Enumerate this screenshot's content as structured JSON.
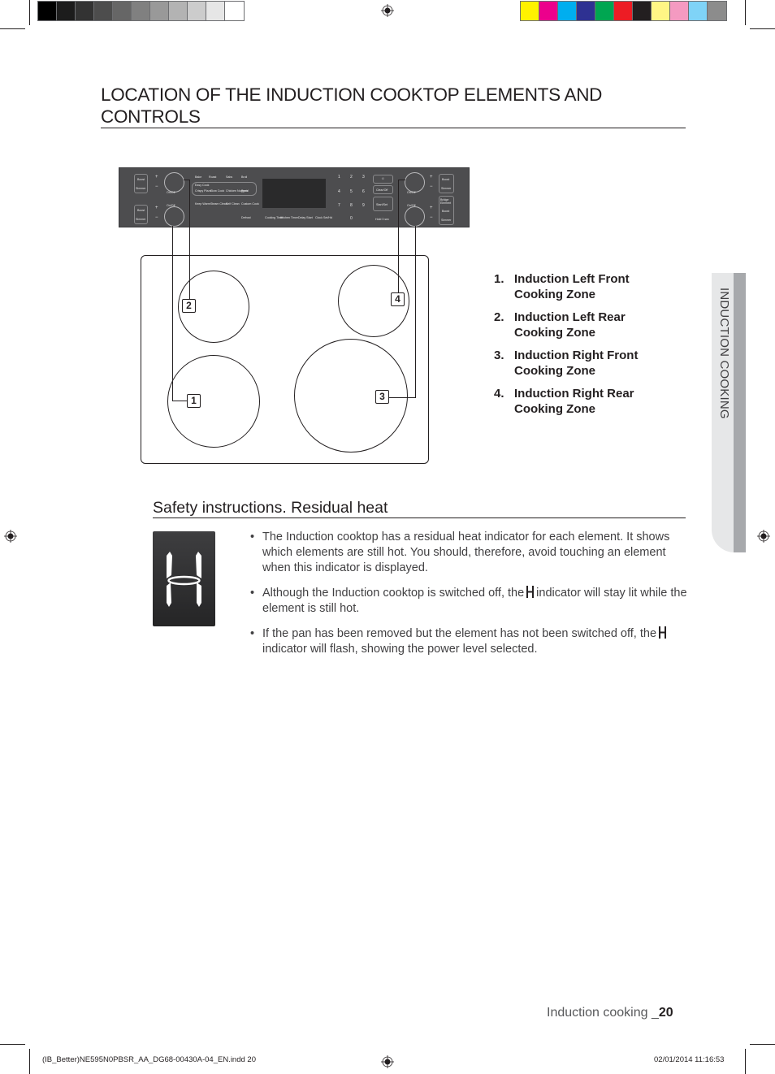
{
  "print_marks": {
    "gray_swatches": [
      "#000000",
      "#1c1c1c",
      "#333333",
      "#4d4d4d",
      "#666666",
      "#808080",
      "#999999",
      "#b3b3b3",
      "#cccccc",
      "#e6e6e6",
      "#ffffff"
    ],
    "color_swatches": [
      "#fff200",
      "#ec008c",
      "#00aeef",
      "#2e3192",
      "#00a651",
      "#ed1c24",
      "#231f20",
      "#fff685",
      "#f49ac1",
      "#7fd3f7",
      "#8c8c8c"
    ]
  },
  "page": {
    "title_line1": "LOCATION OF THE INDUCTION COOKTOP ELEMENTS AND",
    "title_line2": "CONTROLS",
    "side_tab": "INDUCTION COOKING"
  },
  "control_panel": {
    "left_top": {
      "boost": "Boost",
      "simmer": "Simmer",
      "onoff": "On/Off"
    },
    "left_bottom": {
      "boost": "Boost",
      "simmer": "Simmer",
      "onoff": "On/Off"
    },
    "right_top": {
      "boost": "Boost",
      "simmer": "Simmer",
      "onoff": "On/Off"
    },
    "right_bottom": {
      "boost": "Boost",
      "simmer": "Simmer",
      "onoff": "On/Off",
      "extra": "Bridge Element"
    },
    "plus": "+",
    "minus": "−",
    "row1": [
      "Bake",
      "Roast",
      "Sabs",
      "Broil"
    ],
    "easy_cook": "Easy Cook",
    "row2": [
      "Crispy Pizza",
      "Slow Cook",
      "Chicken Nuggets",
      "Proof"
    ],
    "row3": [
      "Keep Warm",
      "Steam Clean",
      "Self Clean",
      "Custom Cook"
    ],
    "row4": [
      "Defrost",
      "Cooking Time",
      "Kitchen Timer",
      "Delay Start",
      "Clock Set/Hd"
    ],
    "keypad": [
      "1",
      "2",
      "3",
      "4",
      "5",
      "6",
      "7",
      "8",
      "9",
      "0"
    ],
    "oven_light": "☼",
    "clear_off": "Clear/Off",
    "start_set": "Start/Set",
    "hold_lock": "Hold 3 sec"
  },
  "callouts": [
    "1",
    "2",
    "3",
    "4"
  ],
  "zones": [
    {
      "num": "1.",
      "line1": "Induction Left Front",
      "line2": "Cooking Zone"
    },
    {
      "num": "2.",
      "line1": "Induction Left Rear",
      "line2": "Cooking Zone"
    },
    {
      "num": "3.",
      "line1": "Induction Right Front",
      "line2": "Cooking Zone"
    },
    {
      "num": "4.",
      "line1": "Induction Right Rear",
      "line2": "Cooking Zone"
    }
  ],
  "safety": {
    "title": "Safety instructions. Residual heat",
    "bullet1": "The Induction cooktop has a residual heat indicator for each element. It shows which elements are still hot. You should, therefore, avoid touching an element when this indicator is displayed.",
    "bullet2_a": "Although the Induction cooktop is switched off, the",
    "bullet2_b": "indicator will stay lit while the element is still hot.",
    "bullet3_a": "If the pan has been removed but the element has not been switched off, the",
    "bullet3_b": "indicator will flash, showing the power level selected."
  },
  "footer": {
    "section": "Induction cooking _",
    "page_number": "20",
    "slug_file": "(IB_Better)NE595N0PBSR_AA_DG68-00430A-04_EN.indd   20",
    "slug_date": "02/01/2014   11:16:53"
  }
}
